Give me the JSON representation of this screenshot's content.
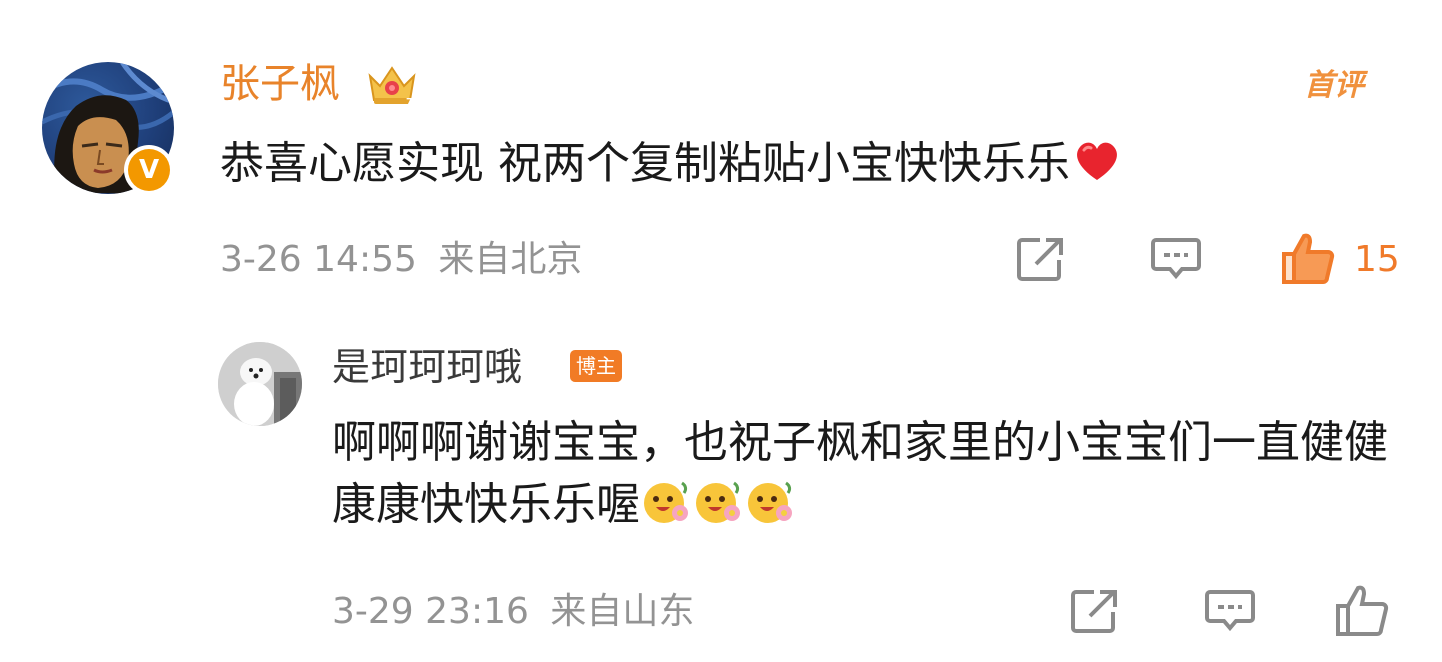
{
  "comment": {
    "author": "张子枫",
    "first_comment_tag": "首评",
    "text": "恭喜心愿实现 祝两个复制粘贴小宝快快乐乐",
    "text_emoji": "red-heart",
    "time": "3-26 14:55",
    "location": "来自北京",
    "like_count": "15",
    "verified_badge": "V"
  },
  "reply": {
    "author": "是珂珂珂哦",
    "author_badge": "博主",
    "text": "啊啊啊谢谢宝宝，也祝子枫和家里的小宝宝们一直健健康康快快乐乐喔",
    "text_emoji": [
      "flower-face",
      "flower-face",
      "flower-face"
    ],
    "time": "3-29 23:16",
    "location": "来自山东"
  },
  "colors": {
    "accent_orange": "#e8832a",
    "like_active": "#f07a2a",
    "meta_gray": "#939393"
  }
}
